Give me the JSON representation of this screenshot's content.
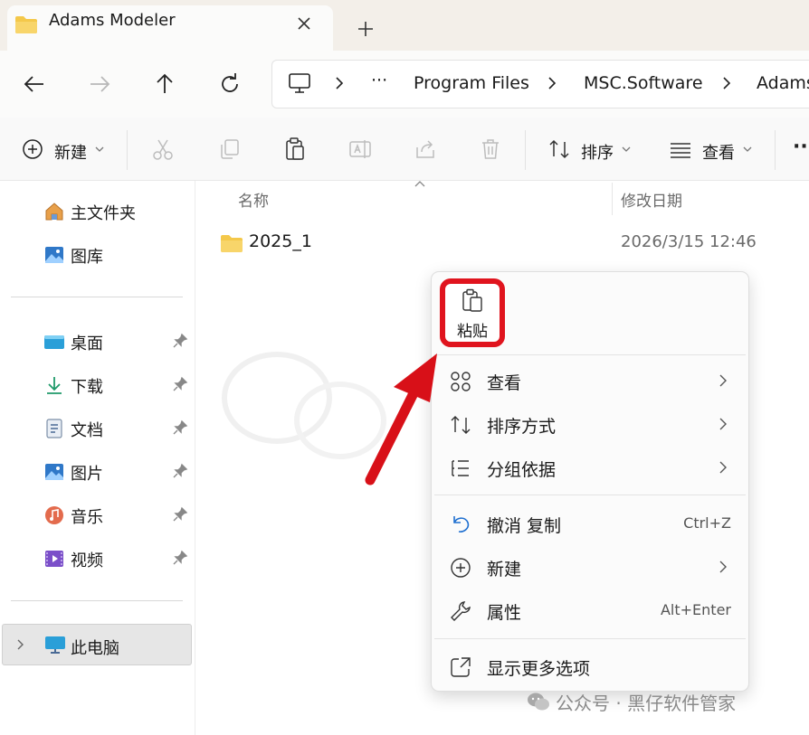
{
  "window": {
    "tab_title": "Adams Modeler",
    "tab_close": "✕",
    "new_tab": "+"
  },
  "address": {
    "ellipsis": "···",
    "crumbs": [
      "Program Files",
      "MSC.Software",
      "Adams"
    ]
  },
  "toolbar": {
    "new_label": "新建",
    "sort_label": "排序",
    "view_label": "查看",
    "more": "···"
  },
  "nav": {
    "home": "主文件夹",
    "gallery": "图库",
    "desktop": "桌面",
    "downloads": "下载",
    "documents": "文档",
    "pictures": "图片",
    "music": "音乐",
    "videos": "视频",
    "this_pc": "此电脑"
  },
  "columns": {
    "name": "名称",
    "modified": "修改日期"
  },
  "files": [
    {
      "name": "2025_1",
      "modified": "2026/3/15 12:46"
    }
  ],
  "context_menu": {
    "paste": "粘贴",
    "items": [
      {
        "label": "查看",
        "shortcut": "",
        "submenu": true,
        "icon": "grid-icon"
      },
      {
        "label": "排序方式",
        "shortcut": "",
        "submenu": true,
        "icon": "sort-icon"
      },
      {
        "label": "分组依据",
        "shortcut": "",
        "submenu": true,
        "icon": "list-icon"
      },
      {
        "label": "撤消 复制",
        "shortcut": "Ctrl+Z",
        "submenu": false,
        "icon": "undo-icon"
      },
      {
        "label": "新建",
        "shortcut": "",
        "submenu": true,
        "icon": "plus-circle-icon"
      },
      {
        "label": "属性",
        "shortcut": "Alt+Enter",
        "submenu": false,
        "icon": "wrench-icon"
      },
      {
        "label": "显示更多选项",
        "shortcut": "",
        "submenu": false,
        "icon": "external-icon"
      }
    ]
  },
  "footer": {
    "text": "公众号 · 黑仔软件管家"
  },
  "colors": {
    "highlight_red": "#e0141e",
    "folder_yellow": "#f4c84a",
    "accent_blue": "#1e6fd0"
  }
}
